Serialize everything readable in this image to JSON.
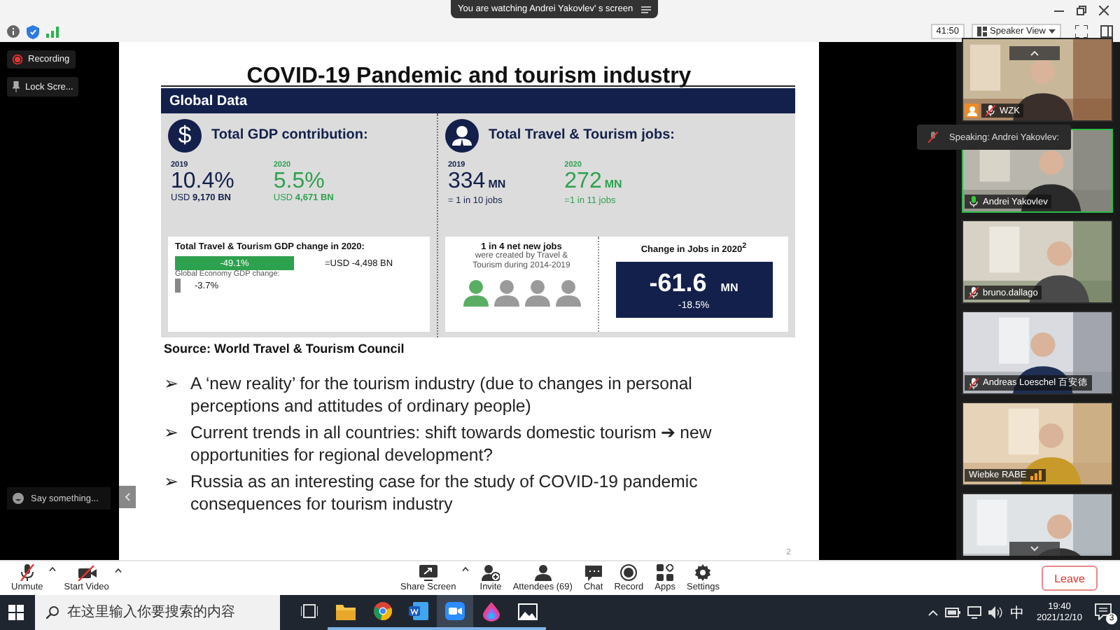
{
  "banner": {
    "text": "You are watching Andrei Yakovlev' s screen"
  },
  "meeting_bar": {
    "timer": "41:50",
    "view": "Speaker View"
  },
  "side_overlay": {
    "recording": "Recording",
    "lock": "Lock Scre...",
    "chat_placeholder": "Say something..."
  },
  "slide": {
    "title": "COVID-19 Pandemic and tourism industry",
    "panel": {
      "header": "Global Data",
      "gdp": {
        "icon": "$",
        "heading": "Total GDP contribution:",
        "stats": [
          {
            "year": "2019",
            "value": "10.4%",
            "sub_label": "USD",
            "sub_value": "9,170 BN",
            "highlight": false
          },
          {
            "year": "2020",
            "value": "5.5%",
            "sub_label": "USD",
            "sub_value": "4,671 BN",
            "highlight": true
          }
        ],
        "change_heading": "Total Travel & Tourism GDP change in 2020:",
        "change_value": "-49.1%",
        "change_usd": "=USD -4,498 BN",
        "global_label": "Global Economy GDP change:",
        "global_value": "-3.7%"
      },
      "jobs": {
        "heading": "Total Travel & Tourism jobs:",
        "stats": [
          {
            "year": "2019",
            "value": "334",
            "unit": "MN",
            "sub_label": "= 1 in 10 jobs",
            "highlight": false
          },
          {
            "year": "2020",
            "value": "272",
            "unit": "MN",
            "sub_label": "=1 in 11 jobs",
            "highlight": true
          }
        ],
        "net_heading": "1 in 4 net new jobs",
        "net_text": "were created by Travel & Tourism during 2014-2019",
        "people": [
          {
            "highlighted": true
          },
          {
            "highlighted": false
          },
          {
            "highlighted": false
          },
          {
            "highlighted": false
          }
        ],
        "change_heading": "Change in Jobs in 2020$^{2}$",
        "change_value": "-61.6",
        "change_unit": "MN",
        "change_pct": "-18.5%"
      }
    },
    "source": "Source: World Travel & Tourism Council",
    "bullets": [
      {
        "marker": "➢",
        "text": "A ‘new reality’ for the tourism industry (due to changes in personal perceptions and attitudes of ordinary people)"
      },
      {
        "marker": "➢",
        "text": "Current trends in all countries: shift towards domestic tourism ➔ new opportunities for regional development?"
      },
      {
        "marker": "➢",
        "text": "Russia as an interesting case for the study of COVID-19 pandemic consequences for tourism industry"
      }
    ],
    "page": "2"
  },
  "gallery": {
    "tooltip": "Speaking: Andrei Yakovlev:",
    "tiles": [
      {
        "name": "WZK",
        "host": true,
        "muted": true,
        "speaking": false,
        "weak_signal": false
      },
      {
        "name": "Andrei Yakovlev",
        "host": false,
        "muted": false,
        "speaking": true,
        "weak_signal": false
      },
      {
        "name": "bruno.dallago",
        "host": false,
        "muted": true,
        "speaking": false,
        "weak_signal": false
      },
      {
        "name": "Andreas Loeschel 百安德",
        "host": false,
        "muted": true,
        "speaking": false,
        "weak_signal": false
      },
      {
        "name": "Wiebke RABE",
        "host": false,
        "muted": false,
        "speaking": false,
        "weak_signal": true
      },
      {
        "host": false,
        "muted": false,
        "speaking": false,
        "weak_signal": false
      }
    ]
  },
  "toolbar": {
    "buttons": [
      {
        "kind": "mic-muted",
        "label": "Unmute",
        "menu": true
      },
      {
        "kind": "video-off",
        "label": "Start Video",
        "menu": true
      },
      {
        "kind": "share",
        "label": "Share Screen",
        "menu": true
      },
      {
        "kind": "invite",
        "label": "Invite",
        "menu": false
      },
      {
        "kind": "attendees",
        "label": "Attendees (69)",
        "menu": false
      },
      {
        "kind": "chat",
        "label": "Chat",
        "menu": false
      },
      {
        "kind": "record",
        "label": "Record",
        "menu": false
      },
      {
        "kind": "apps",
        "label": "Apps",
        "menu": false
      },
      {
        "kind": "settings",
        "label": "Settings",
        "menu": false
      }
    ],
    "leave": "Leave"
  },
  "taskbar": {
    "search_placeholder": "在这里输入你要搜索的内容",
    "apps": [
      {
        "kind": "taskview",
        "running": false,
        "selected": false
      },
      {
        "kind": "explorer",
        "running": true,
        "selected": false
      },
      {
        "kind": "browser",
        "running": true,
        "selected": false
      },
      {
        "kind": "word",
        "running": true,
        "selected": false
      },
      {
        "kind": "zoom",
        "running": true,
        "selected": true
      },
      {
        "kind": "paint",
        "running": true,
        "selected": false
      },
      {
        "kind": "photos",
        "running": true,
        "selected": false
      }
    ],
    "ime": "中",
    "time": "19:40",
    "date": "2021/12/10",
    "notifications": "3"
  }
}
